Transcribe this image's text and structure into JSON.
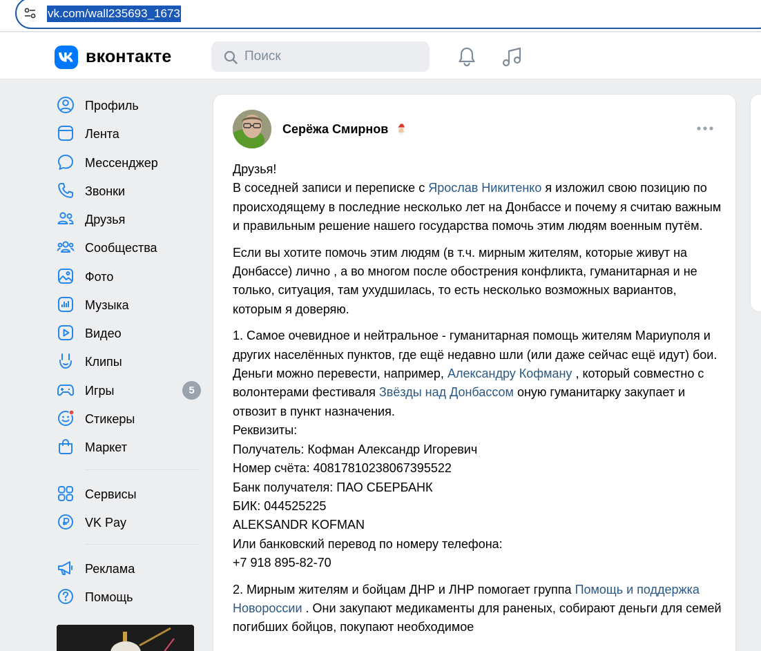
{
  "browser": {
    "url": "vk.com/wall235693_1673"
  },
  "header": {
    "logo_text": "вконтакте",
    "search_placeholder": "Поиск"
  },
  "sidebar": {
    "items": [
      {
        "label": "Профиль",
        "icon": "user-circle-icon"
      },
      {
        "label": "Лента",
        "icon": "newsfeed-icon"
      },
      {
        "label": "Мессенджер",
        "icon": "message-icon"
      },
      {
        "label": "Звонки",
        "icon": "phone-icon"
      },
      {
        "label": "Друзья",
        "icon": "friends-icon"
      },
      {
        "label": "Сообщества",
        "icon": "communities-icon"
      },
      {
        "label": "Фото",
        "icon": "photo-icon"
      },
      {
        "label": "Музыка",
        "icon": "music-icon"
      },
      {
        "label": "Видео",
        "icon": "video-icon"
      },
      {
        "label": "Клипы",
        "icon": "clips-icon"
      },
      {
        "label": "Игры",
        "icon": "games-icon",
        "badge": "5"
      },
      {
        "label": "Стикеры",
        "icon": "stickers-icon"
      },
      {
        "label": "Маркет",
        "icon": "market-icon"
      },
      {
        "label": "Сервисы",
        "icon": "services-icon"
      },
      {
        "label": "VK Pay",
        "icon": "vkpay-icon"
      },
      {
        "label": "Реклама",
        "icon": "ads-icon"
      },
      {
        "label": "Помощь",
        "icon": "help-icon"
      }
    ]
  },
  "post": {
    "author": "Серёжа Смирнов",
    "p1": {
      "line1": "Друзья!",
      "pre_link": "В соседней записи и переписке с ",
      "link": "Ярослав Никитенко",
      "post_link": " я изложил свою позицию по происходящему в последние несколько лет на Донбассе и почему я считаю важным и правильным решение нашего государства помочь этим людям военным путём."
    },
    "p2": "Если вы хотите помочь этим людям (в т.ч. мирным жителям, которые живут на Донбассе) лично , а во многом после обострения конфликта, гуманитарная и не только, ситуация, там ухудшилась, то есть несколько возможных вариантов, которым я доверяю.",
    "p3": {
      "pre": "1. Самое очевидное и нейтральное - гуманитарная помощь жителям Мариуполя и других населённых пунктов, где ещё недавно шли (или даже сейчас ещё идут) бои. Деньги можно перевести, например, ",
      "link1": "Александру Кофману",
      "mid": " , который совместно с волонтерами фестиваля ",
      "link2": "Звёзды над Донбассом",
      "post": " оную гуманитарку закупает и отвозит в пункт назначения.",
      "lines": [
        "Реквизиты:",
        "Получатель: Кофман Александр Игоревич",
        "Номер счёта: 40817810238067395522",
        "Банк получателя: ПАО СБЕРБАНК",
        "БИК: 044525225",
        "ALEKSANDR KOFMAN",
        "Или банковский перевод по номеру телефона:",
        "+7 918 895-82-70"
      ]
    },
    "p4": {
      "pre": "2. Мирным жителям и бойцам ДНР и ЛНР помогает группа ",
      "link": "Помощь и поддержка Новороссии",
      "post": " . Они закупают медикаменты для раненых, собирают деньги для семей погибших бойцов, покупают необходимое"
    }
  },
  "colors": {
    "vk_blue": "#0077ff",
    "link": "#2a5885",
    "page_bg": "#edeef0",
    "badge": "#99a2ad",
    "sticker_dot": "#e64646"
  }
}
